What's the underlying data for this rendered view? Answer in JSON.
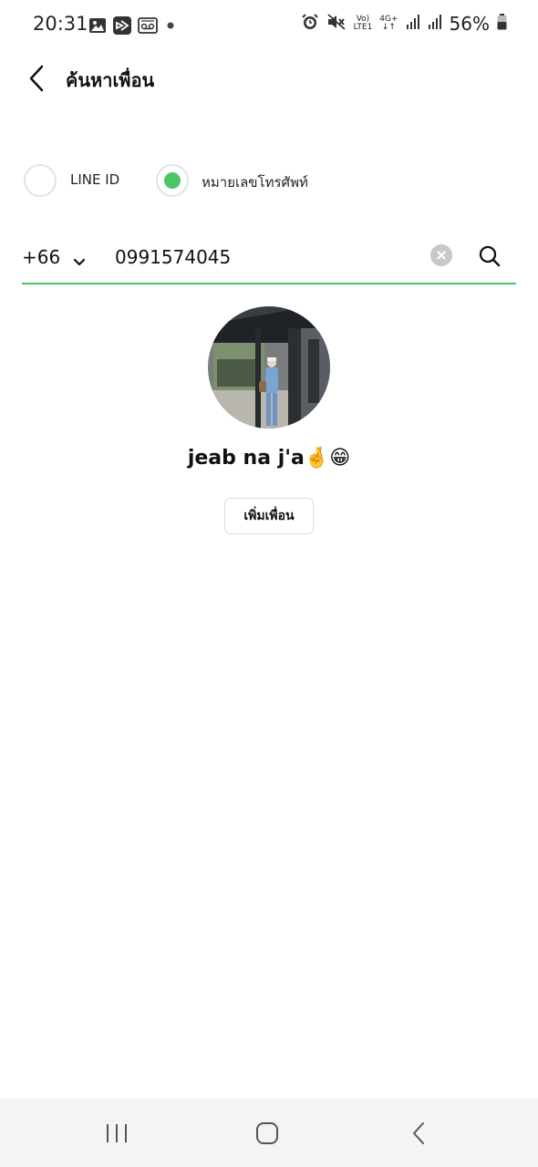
{
  "status_bar": {
    "time": "20:31",
    "network_top": "Vo)",
    "network_bottom": "LTE1",
    "data_type": "4G+",
    "battery": "56%",
    "left_icons": [
      "gallery-icon",
      "app-icon",
      "voicemail-icon",
      "dot-icon"
    ],
    "right_icons": [
      "alarm-icon",
      "mute-icon",
      "signal-icon",
      "signal-icon",
      "battery-icon"
    ]
  },
  "header": {
    "title": "ค้นหาเพื่อน"
  },
  "search_type": {
    "options": [
      {
        "label": "LINE ID",
        "selected": false
      },
      {
        "label": "หมายเลขโทรศัพท์",
        "selected": true
      }
    ],
    "accent_color": "#4cc764"
  },
  "search": {
    "country_code": "+66",
    "phone_value": "0991574045"
  },
  "result": {
    "name": "jeab na j'a🤞😁",
    "add_label": "เพิ่มเพื่อน"
  },
  "nav": {
    "items": [
      "recents-icon",
      "home-icon",
      "back-icon"
    ]
  }
}
